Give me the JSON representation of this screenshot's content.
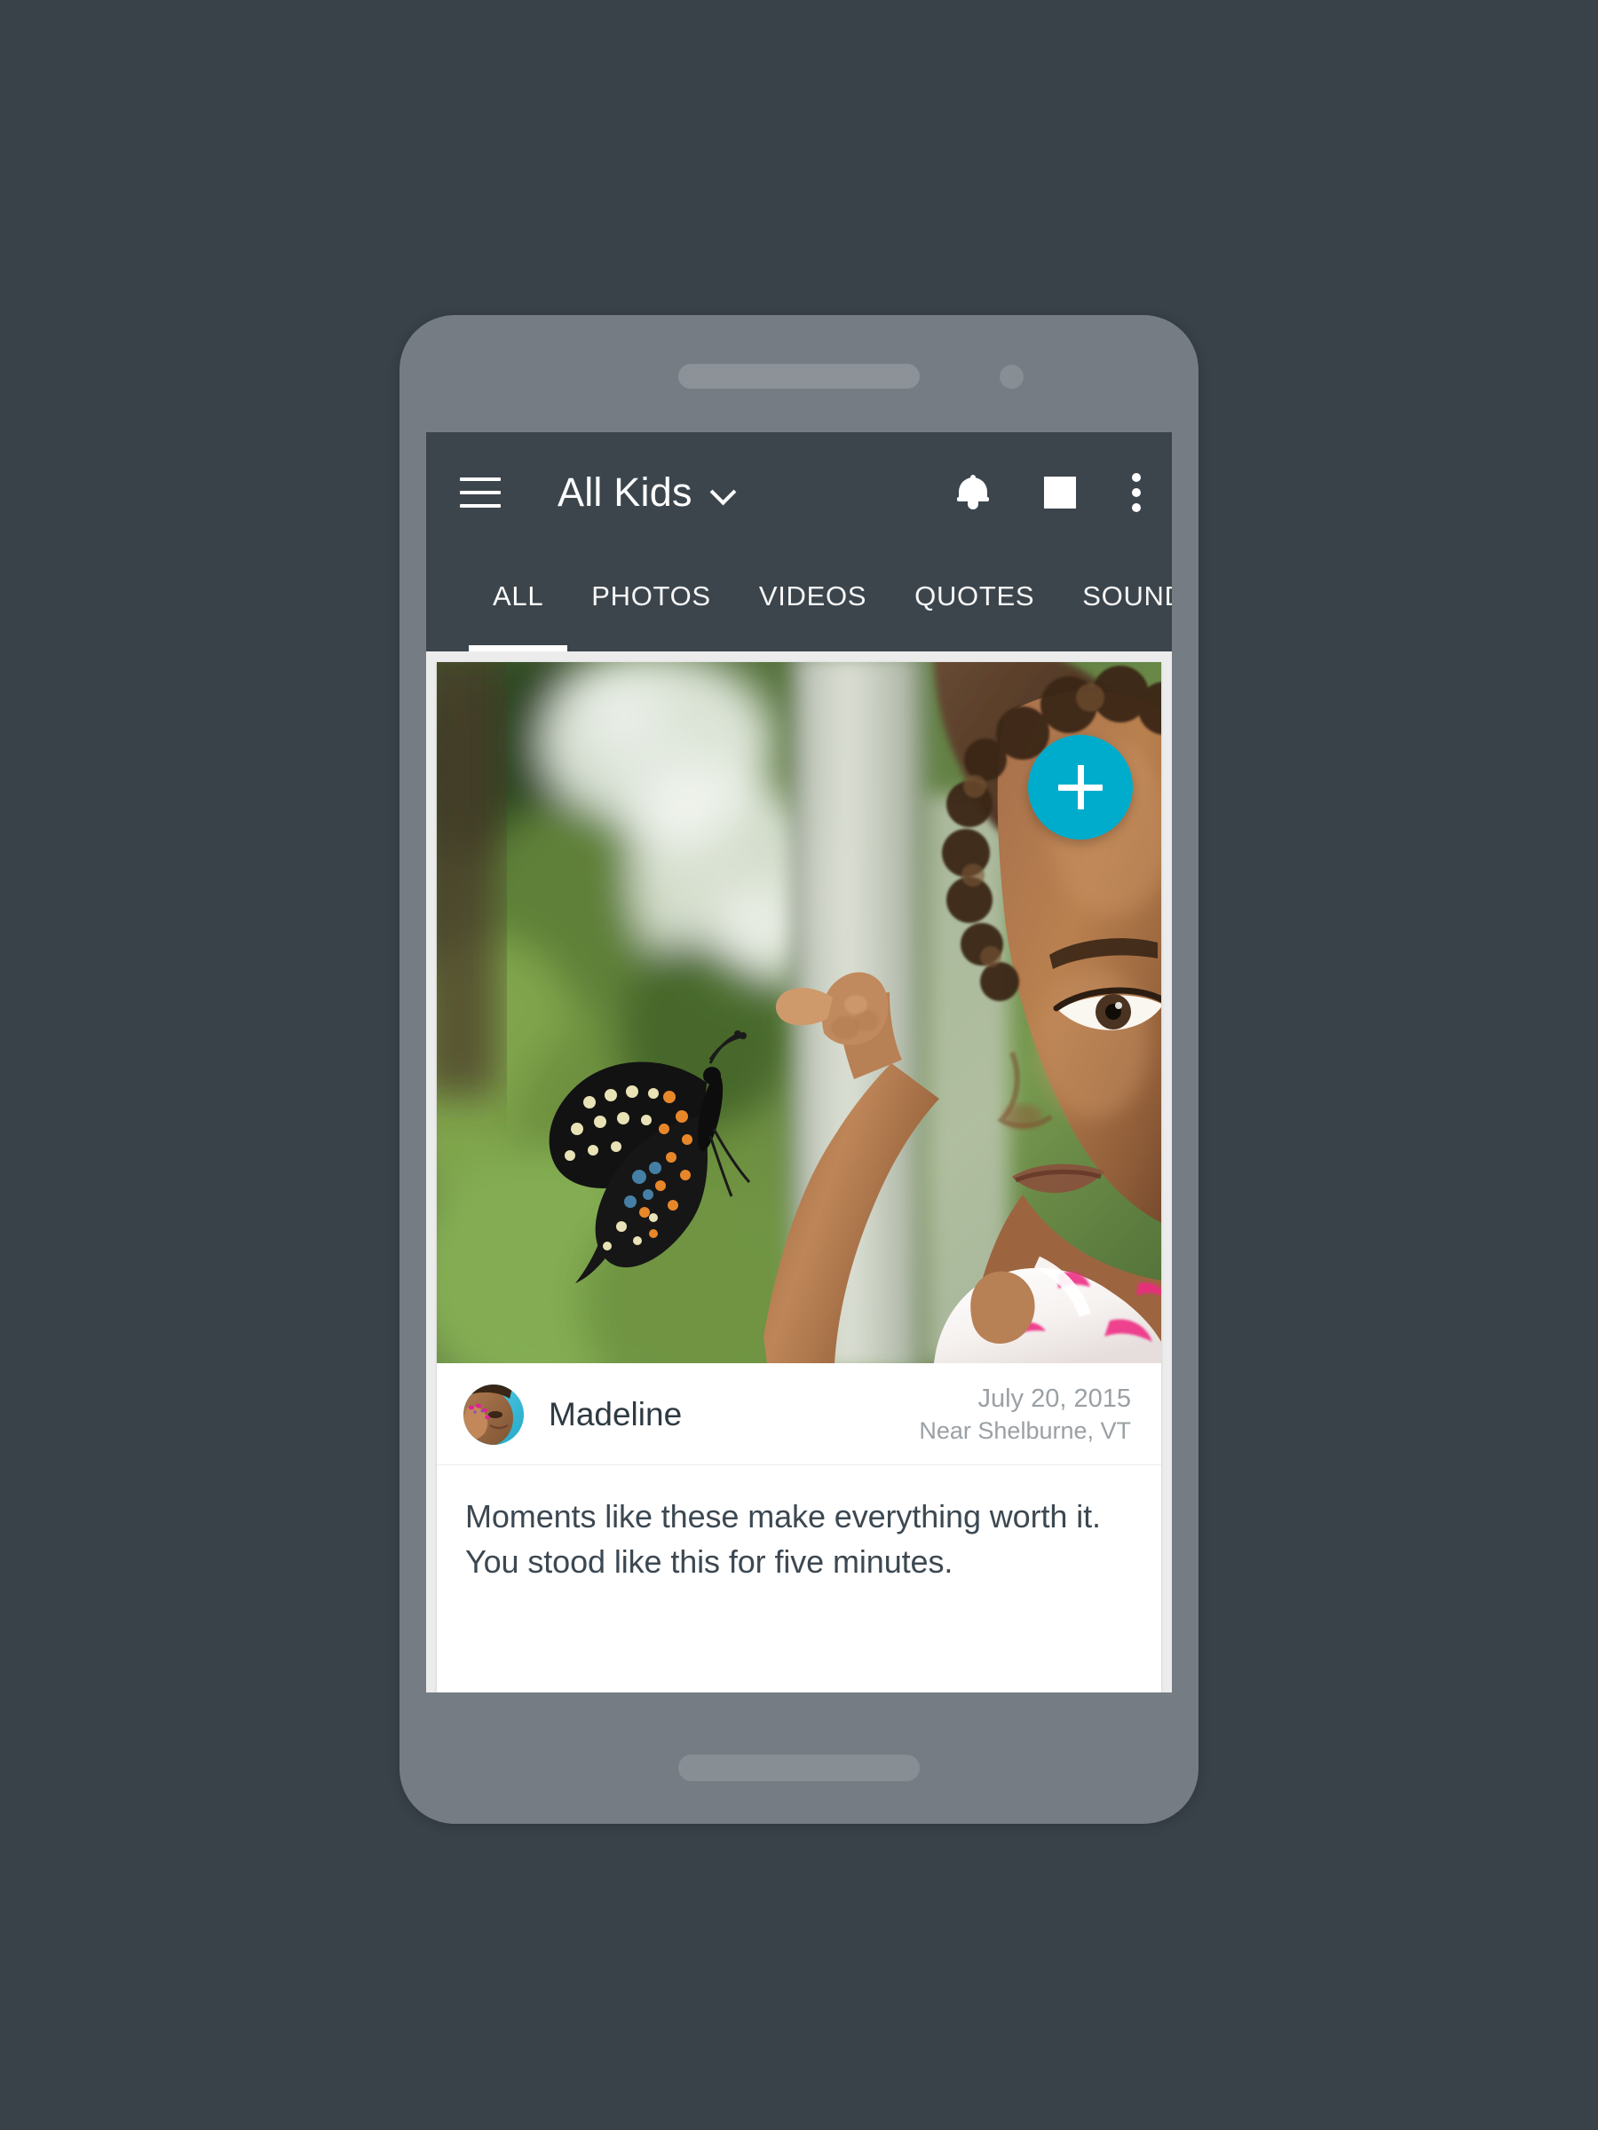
{
  "theme": {
    "page_background": "#394249",
    "device_body": "#757C84",
    "app_bar": "#3C454C",
    "screen_background": "#ECECEC",
    "card": "#FFFFFF",
    "accent_fab": "#00ACCC",
    "primary_text": "#3C4852",
    "secondary_text": "#9AA0A4"
  },
  "device": {
    "speaker_name": "speaker-grille",
    "camera_name": "front-camera",
    "home_bar_name": "home-bar"
  },
  "app_bar": {
    "menu_icon": "hamburger-menu-icon",
    "title": "All Kids",
    "title_chevron": "chevron-down-icon",
    "actions": [
      {
        "icon": "bell-icon",
        "label": "Notifications"
      },
      {
        "icon": "square-icon",
        "label": "Stop"
      },
      {
        "icon": "overflow-menu-icon",
        "label": "More options"
      }
    ]
  },
  "tabs": {
    "active_index": 0,
    "items": [
      {
        "label": "ALL",
        "active": true
      },
      {
        "label": "PHOTOS",
        "active": false
      },
      {
        "label": "VIDEOS",
        "active": false
      },
      {
        "label": "QUOTES",
        "active": false
      },
      {
        "label": "SOUND",
        "active": false
      }
    ]
  },
  "post": {
    "photo_alt": "Young child with curly hair watching a black swallowtail butterfly perched on her fingertip, blurred green garden and white fence behind",
    "avatar_alt": "Close-up portrait of a young girl resting her painted-nail hand on her cheek",
    "author": "Madeline",
    "date": "July 20, 2015",
    "location": "Near Shelburne, VT",
    "caption": "Moments like these make everything worth it. You stood like this for five minutes."
  },
  "fab": {
    "icon": "plus-icon",
    "label": "Add"
  }
}
